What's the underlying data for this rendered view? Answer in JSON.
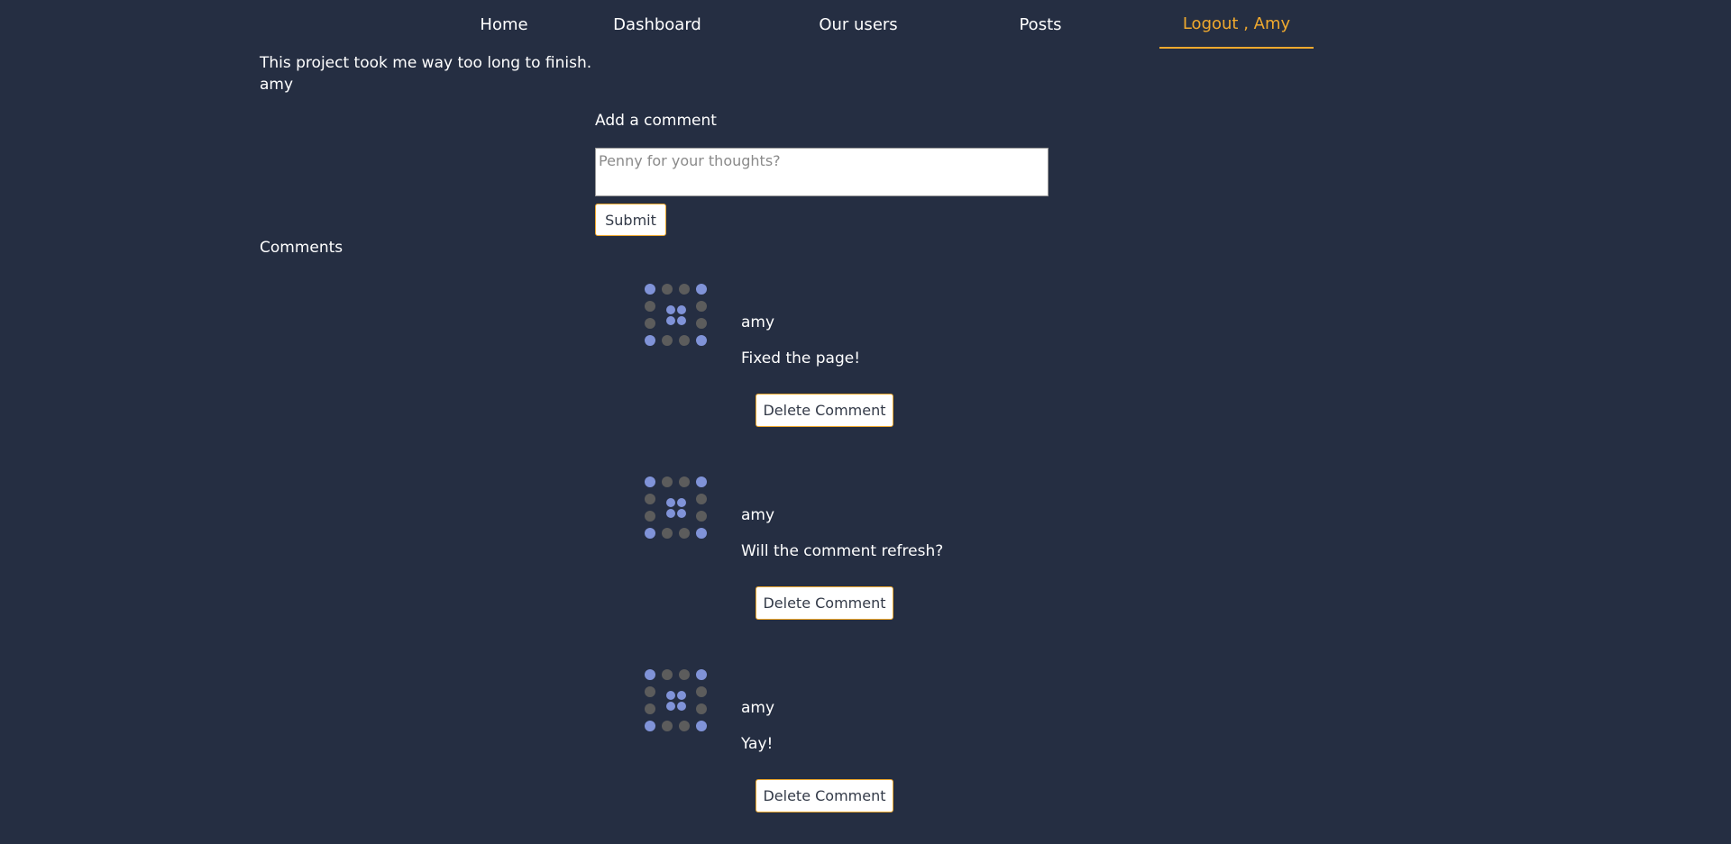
{
  "nav": {
    "home": "Home",
    "dashboard": "Dashboard",
    "users": "Our users",
    "posts": "Posts",
    "logout": "Logout , Amy"
  },
  "post": {
    "text": "This project took me way too long to finish.",
    "author": "amy"
  },
  "comment_form": {
    "label": "Add a comment",
    "placeholder": "Penny for your thoughts?",
    "value": "",
    "submit_label": "Submit"
  },
  "comments_heading": "Comments",
  "comments": [
    {
      "author": "amy",
      "text": "Fixed the page!",
      "delete_label": "Delete Comment",
      "avatar_icon": "identicon-dots-icon"
    },
    {
      "author": "amy",
      "text": "Will the comment refresh?",
      "delete_label": "Delete Comment",
      "avatar_icon": "identicon-dots-icon"
    },
    {
      "author": "amy",
      "text": "Yay!",
      "delete_label": "Delete Comment",
      "avatar_icon": "identicon-dots-icon"
    }
  ],
  "colors": {
    "background": "#252e42",
    "accent": "#f0a92e",
    "avatar_blue": "#8093d8",
    "avatar_grey": "#5c5c5c"
  }
}
